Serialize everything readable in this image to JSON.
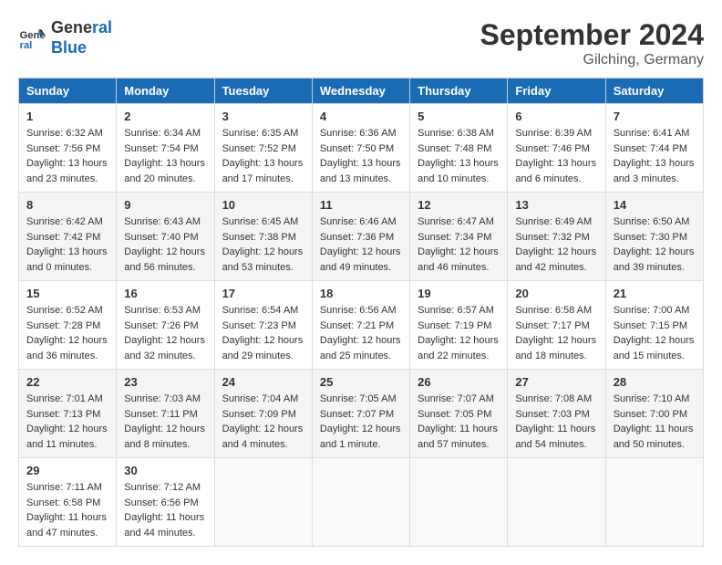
{
  "header": {
    "logo_line1": "General",
    "logo_line2": "Blue",
    "month_title": "September 2024",
    "location": "Gilching, Germany"
  },
  "weekdays": [
    "Sunday",
    "Monday",
    "Tuesday",
    "Wednesday",
    "Thursday",
    "Friday",
    "Saturday"
  ],
  "weeks": [
    [
      {
        "day": "1",
        "info": "Sunrise: 6:32 AM\nSunset: 7:56 PM\nDaylight: 13 hours\nand 23 minutes."
      },
      {
        "day": "2",
        "info": "Sunrise: 6:34 AM\nSunset: 7:54 PM\nDaylight: 13 hours\nand 20 minutes."
      },
      {
        "day": "3",
        "info": "Sunrise: 6:35 AM\nSunset: 7:52 PM\nDaylight: 13 hours\nand 17 minutes."
      },
      {
        "day": "4",
        "info": "Sunrise: 6:36 AM\nSunset: 7:50 PM\nDaylight: 13 hours\nand 13 minutes."
      },
      {
        "day": "5",
        "info": "Sunrise: 6:38 AM\nSunset: 7:48 PM\nDaylight: 13 hours\nand 10 minutes."
      },
      {
        "day": "6",
        "info": "Sunrise: 6:39 AM\nSunset: 7:46 PM\nDaylight: 13 hours\nand 6 minutes."
      },
      {
        "day": "7",
        "info": "Sunrise: 6:41 AM\nSunset: 7:44 PM\nDaylight: 13 hours\nand 3 minutes."
      }
    ],
    [
      {
        "day": "8",
        "info": "Sunrise: 6:42 AM\nSunset: 7:42 PM\nDaylight: 13 hours\nand 0 minutes."
      },
      {
        "day": "9",
        "info": "Sunrise: 6:43 AM\nSunset: 7:40 PM\nDaylight: 12 hours\nand 56 minutes."
      },
      {
        "day": "10",
        "info": "Sunrise: 6:45 AM\nSunset: 7:38 PM\nDaylight: 12 hours\nand 53 minutes."
      },
      {
        "day": "11",
        "info": "Sunrise: 6:46 AM\nSunset: 7:36 PM\nDaylight: 12 hours\nand 49 minutes."
      },
      {
        "day": "12",
        "info": "Sunrise: 6:47 AM\nSunset: 7:34 PM\nDaylight: 12 hours\nand 46 minutes."
      },
      {
        "day": "13",
        "info": "Sunrise: 6:49 AM\nSunset: 7:32 PM\nDaylight: 12 hours\nand 42 minutes."
      },
      {
        "day": "14",
        "info": "Sunrise: 6:50 AM\nSunset: 7:30 PM\nDaylight: 12 hours\nand 39 minutes."
      }
    ],
    [
      {
        "day": "15",
        "info": "Sunrise: 6:52 AM\nSunset: 7:28 PM\nDaylight: 12 hours\nand 36 minutes."
      },
      {
        "day": "16",
        "info": "Sunrise: 6:53 AM\nSunset: 7:26 PM\nDaylight: 12 hours\nand 32 minutes."
      },
      {
        "day": "17",
        "info": "Sunrise: 6:54 AM\nSunset: 7:23 PM\nDaylight: 12 hours\nand 29 minutes."
      },
      {
        "day": "18",
        "info": "Sunrise: 6:56 AM\nSunset: 7:21 PM\nDaylight: 12 hours\nand 25 minutes."
      },
      {
        "day": "19",
        "info": "Sunrise: 6:57 AM\nSunset: 7:19 PM\nDaylight: 12 hours\nand 22 minutes."
      },
      {
        "day": "20",
        "info": "Sunrise: 6:58 AM\nSunset: 7:17 PM\nDaylight: 12 hours\nand 18 minutes."
      },
      {
        "day": "21",
        "info": "Sunrise: 7:00 AM\nSunset: 7:15 PM\nDaylight: 12 hours\nand 15 minutes."
      }
    ],
    [
      {
        "day": "22",
        "info": "Sunrise: 7:01 AM\nSunset: 7:13 PM\nDaylight: 12 hours\nand 11 minutes."
      },
      {
        "day": "23",
        "info": "Sunrise: 7:03 AM\nSunset: 7:11 PM\nDaylight: 12 hours\nand 8 minutes."
      },
      {
        "day": "24",
        "info": "Sunrise: 7:04 AM\nSunset: 7:09 PM\nDaylight: 12 hours\nand 4 minutes."
      },
      {
        "day": "25",
        "info": "Sunrise: 7:05 AM\nSunset: 7:07 PM\nDaylight: 12 hours\nand 1 minute."
      },
      {
        "day": "26",
        "info": "Sunrise: 7:07 AM\nSunset: 7:05 PM\nDaylight: 11 hours\nand 57 minutes."
      },
      {
        "day": "27",
        "info": "Sunrise: 7:08 AM\nSunset: 7:03 PM\nDaylight: 11 hours\nand 54 minutes."
      },
      {
        "day": "28",
        "info": "Sunrise: 7:10 AM\nSunset: 7:00 PM\nDaylight: 11 hours\nand 50 minutes."
      }
    ],
    [
      {
        "day": "29",
        "info": "Sunrise: 7:11 AM\nSunset: 6:58 PM\nDaylight: 11 hours\nand 47 minutes."
      },
      {
        "day": "30",
        "info": "Sunrise: 7:12 AM\nSunset: 6:56 PM\nDaylight: 11 hours\nand 44 minutes."
      },
      null,
      null,
      null,
      null,
      null
    ]
  ]
}
